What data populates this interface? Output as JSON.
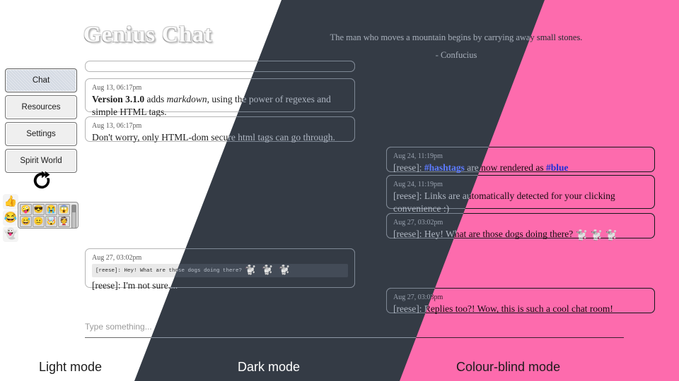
{
  "app": {
    "title": "Genius Chat",
    "quote": "The man who moves a mountain begins by carrying away small stones.",
    "quote_author": "- Confucius"
  },
  "colors": {
    "light_bg": "#ffffff",
    "dark_bg": "#343b45",
    "colour_blind_bg": "#fd6bad",
    "hashtag": "#1f3fd8",
    "link": "#2f6fd0"
  },
  "sidebar": {
    "items": [
      {
        "label": "Chat",
        "selected": true
      },
      {
        "label": "Resources",
        "selected": false
      },
      {
        "label": "Settings",
        "selected": false
      },
      {
        "label": "Spirit World",
        "selected": false
      }
    ],
    "refresh_icon": "refresh-icon"
  },
  "reactions": {
    "items": [
      "👍",
      "😂",
      "👻"
    ],
    "picker": {
      "emojis": [
        "🤪",
        "😎",
        "😭",
        "😱",
        "😅",
        "😐",
        "🤯",
        "👰"
      ],
      "scrollbar": "emoji-scrollbar"
    }
  },
  "messages": [
    {
      "id": "m0",
      "timestamp": "",
      "kind": "partial",
      "text": ""
    },
    {
      "id": "m1",
      "timestamp": "Aug 13, 06:17pm",
      "kind": "markdown",
      "text": "Version 3.1.0 adds markdown, using the power of regexes and simple HTML tags."
    },
    {
      "id": "m2",
      "timestamp": "Aug 13, 06:17pm",
      "kind": "plain",
      "text": "Don't worry, only HTML-dom secure html tags can go through."
    },
    {
      "id": "m3",
      "timestamp": "Aug 24, 11:19pm",
      "kind": "hashtag",
      "text": "[reese]: #hashtags are now rendered as #blue",
      "hashtag_1": "#hashtags",
      "hashtag_2": "#blue"
    },
    {
      "id": "m4",
      "timestamp": "Aug 24, 11:19pm",
      "kind": "link",
      "text": "[reese]: Links are automatically detected for your clicking convenience :)",
      "link": "https://example.com/"
    },
    {
      "id": "m5",
      "timestamp": "Aug 27, 03:02pm",
      "kind": "emoji",
      "text": "[reese]: Hey! What are those dogs doing there?",
      "emojis": "🐩 🐩 🐩"
    },
    {
      "id": "m6",
      "timestamp": "Aug 27, 03:02pm",
      "kind": "reply",
      "quoted_text": "[reese]: Hey! What are those dogs doing there?",
      "quoted_emojis": "🐩 🐩 🐩",
      "text": "[reese]: I'm not sure...."
    },
    {
      "id": "m7",
      "timestamp": "Aug 27, 03:03pm",
      "kind": "plain",
      "text": "[reese]: Replies too?! Wow, this is such a cool chat room!"
    }
  ],
  "composer": {
    "placeholder": "Type something...",
    "value": ""
  },
  "captions": {
    "light": "Light mode",
    "dark": "Dark mode",
    "colour_blind": "Colour-blind mode"
  }
}
